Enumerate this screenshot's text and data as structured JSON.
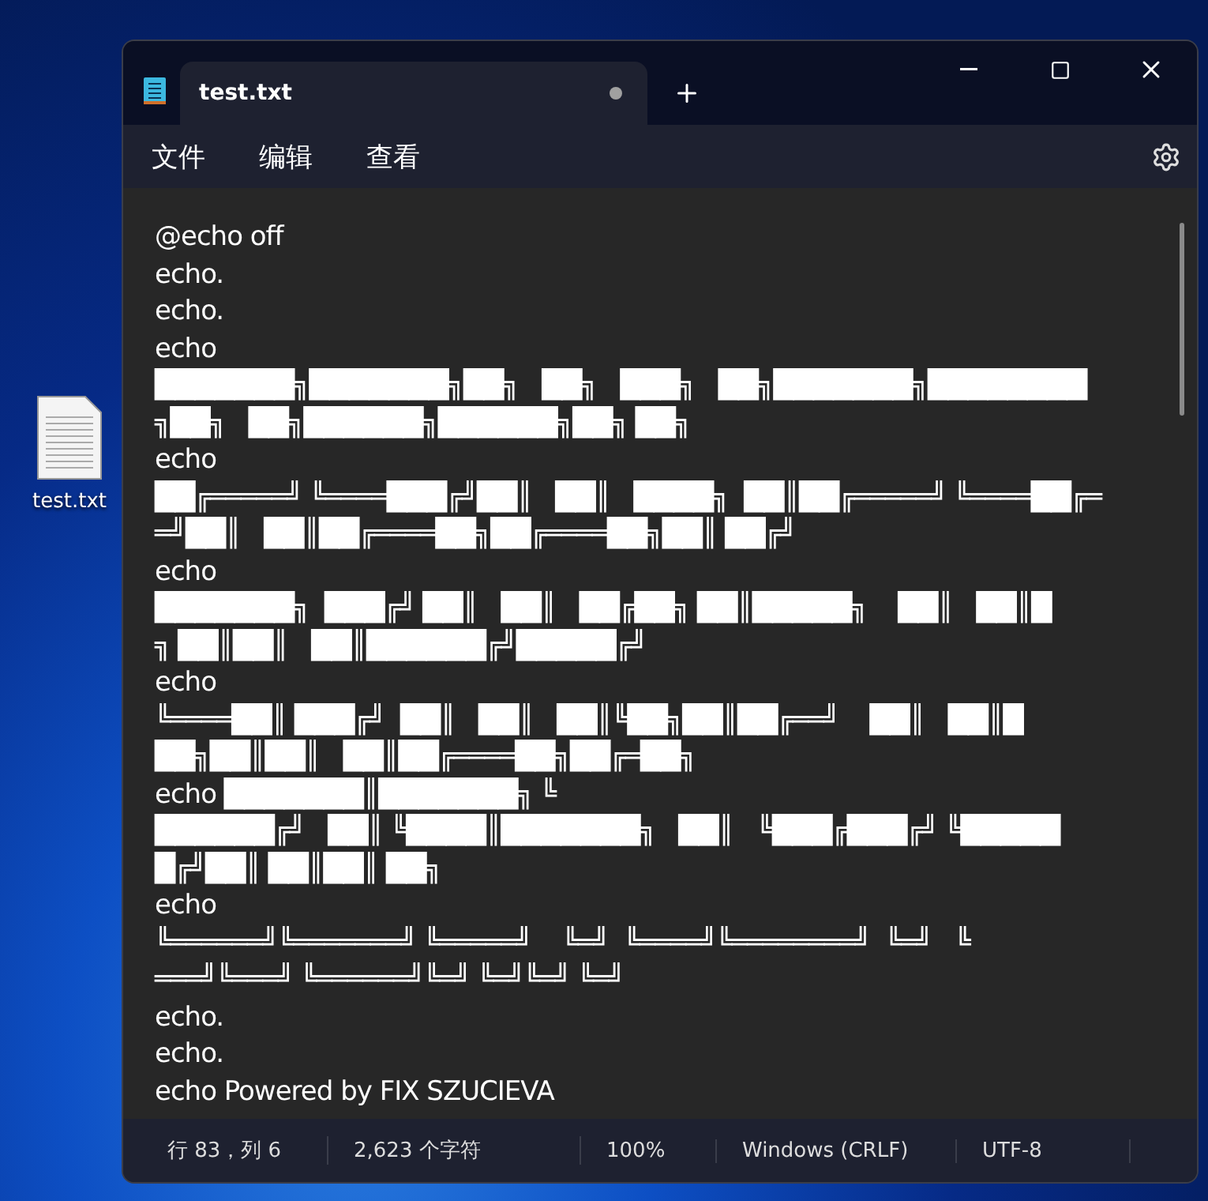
{
  "desktop": {
    "icons": [
      {
        "label": "test.txt"
      }
    ]
  },
  "window": {
    "tabs": [
      {
        "label": "test.txt",
        "selected": true,
        "unsaved": true
      }
    ],
    "menu": [
      "文件",
      "编辑",
      "查看"
    ],
    "editor": {
      "lines": [
        "@echo off",
        "echo.",
        "echo.",
        "echo",
        "███████╗███████╗██╗   ██╗   ███╗   ██╗███████╗████████",
        "╗██╗   ██╗██████╗██████╗██╗ ██╗",
        "echo",
        "██╔═════╝ ╚════███╔╝██║   ██║   ████╗  ██║██╔═════╝ ╚════██╔═",
        "═╝██║   ██║██╔════██╗██╔════██╗██║ ██╔╝",
        "echo",
        "███████╗  ███╔╝ ██║   ██║   ██╔██╗ ██║█████╗    ██║   ██║█",
        "╗ ██║██║   ██║██████╔╝█████╔╝",
        "echo",
        "╚════██║ ███╔╝  ██║   ██║   ██║╚██╗██║██╔══╝    ██║   ██║█",
        "██╗██║██║   ██║██╔════██╗██╔═██╗",
        "echo ███████║███████╗ ╚",
        "██████╔╝   ██║ ╚████║███████╗   ██║   ╚███╔███╔╝ ╚█████",
        "█╔╝██║ ██║██║ ██╗",
        "echo",
        "╚══════╝╚═══════╝ ╚═════╝    ╚═╝  ╚════╝╚════════╝  ╚═╝   ╚",
        "═══╝╚═══╝ ╚══════╝╚═╝ ╚═╝╚═╝ ╚═╝",
        "echo.",
        "echo.",
        "echo Powered by FIX SZUCIEVA"
      ]
    },
    "status_bar": [
      "行 83，列 6",
      "2,623 个字符",
      "100%",
      "Windows (CRLF)",
      "UTF-8"
    ]
  }
}
